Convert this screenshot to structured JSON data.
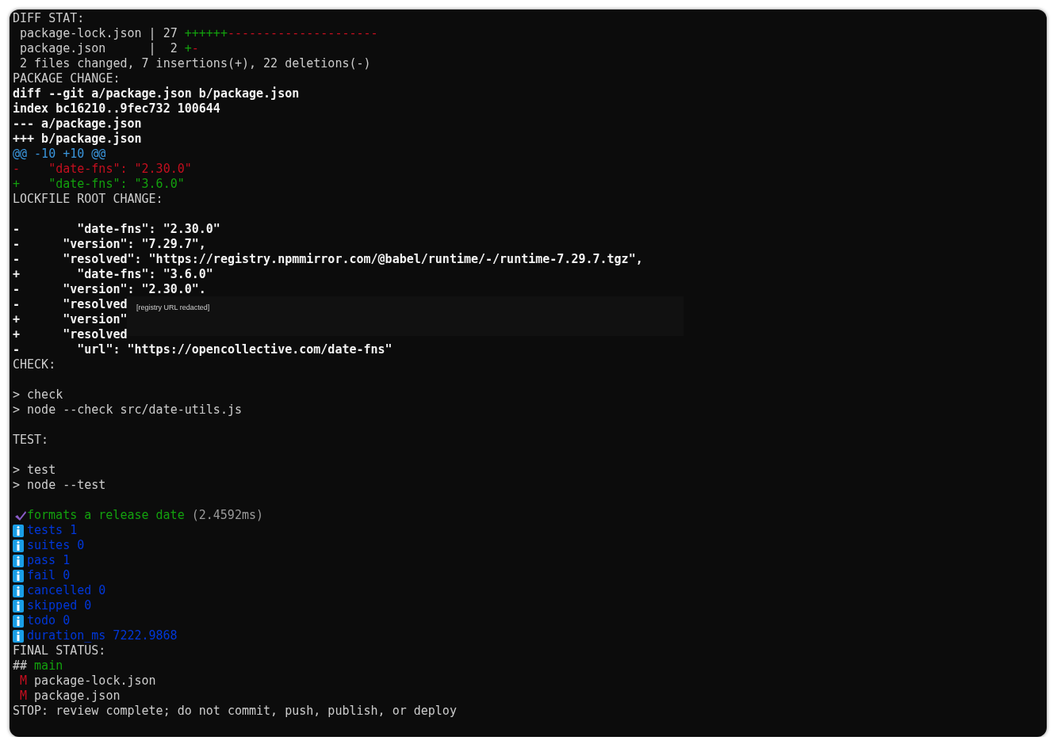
{
  "terminal": {
    "lines": [
      {
        "kind": "text",
        "segments": [
          {
            "kind": "plain",
            "text": "DIFF STAT:"
          }
        ]
      },
      {
        "kind": "text",
        "segments": [
          {
            "kind": "plain",
            "text": " package-lock.json | 27 "
          },
          {
            "kind": "added",
            "text": "++++++"
          },
          {
            "kind": "removed",
            "text": "---------------------"
          }
        ]
      },
      {
        "kind": "text",
        "segments": [
          {
            "kind": "plain",
            "text": " package.json      |  2 "
          },
          {
            "kind": "added",
            "text": "+"
          },
          {
            "kind": "removed",
            "text": "-"
          }
        ]
      },
      {
        "kind": "text",
        "segments": [
          {
            "kind": "plain",
            "text": " 2 files changed, 7 insertions(+), 22 deletions(-)"
          }
        ]
      },
      {
        "kind": "text",
        "segments": [
          {
            "kind": "plain",
            "text": "PACKAGE CHANGE:"
          }
        ]
      },
      {
        "kind": "text",
        "segments": [
          {
            "kind": "bold",
            "text": "diff --git a/package.json b/package.json"
          }
        ]
      },
      {
        "kind": "text",
        "segments": [
          {
            "kind": "bold",
            "text": "index bc16210..9fec732 100644"
          }
        ]
      },
      {
        "kind": "text",
        "segments": [
          {
            "kind": "bold",
            "text": "--- a/package.json"
          }
        ]
      },
      {
        "kind": "text",
        "segments": [
          {
            "kind": "bold",
            "text": "+++ b/package.json"
          }
        ]
      },
      {
        "kind": "text",
        "segments": [
          {
            "kind": "hunk",
            "text": "@@ -10 +10 @@"
          }
        ]
      },
      {
        "kind": "text",
        "segments": [
          {
            "kind": "removed",
            "text": "-    \"date-fns\": \"2.30.0\""
          }
        ]
      },
      {
        "kind": "text",
        "segments": [
          {
            "kind": "added",
            "text": "+    \"date-fns\": \"3.6.0\""
          }
        ]
      },
      {
        "kind": "text",
        "segments": [
          {
            "kind": "plain",
            "text": "LOCKFILE ROOT CHANGE:"
          }
        ]
      },
      {
        "kind": "blank"
      },
      {
        "kind": "text",
        "segments": [
          {
            "kind": "bold",
            "text": "-        \"date-fns\": \"2.30.0\""
          }
        ]
      },
      {
        "kind": "text",
        "segments": [
          {
            "kind": "bold",
            "text": "-      \"version\": \"7.29.7\","
          }
        ]
      },
      {
        "kind": "text",
        "segments": [
          {
            "kind": "bold",
            "text": "-      \"resolved\": \"https://registry.npmmirror.com/@babel/runtime/-/runtime-7.29.7.tgz\","
          }
        ]
      },
      {
        "kind": "text",
        "segments": [
          {
            "kind": "bold",
            "text": "+        \"date-fns\": \"3.6.0\""
          }
        ]
      },
      {
        "kind": "text",
        "segments": [
          {
            "kind": "bold",
            "text": "-      \"version\": \"2.30.0\"."
          }
        ]
      },
      {
        "kind": "text",
        "segments": [
          {
            "kind": "bold",
            "text": "-      \"resolved"
          }
        ],
        "redaction": "[registry URL redacted]"
      },
      {
        "kind": "text",
        "segments": [
          {
            "kind": "bold",
            "text": "+      \"version\""
          }
        ]
      },
      {
        "kind": "text",
        "segments": [
          {
            "kind": "bold",
            "text": "+      \"resolved"
          }
        ]
      },
      {
        "kind": "text",
        "segments": [
          {
            "kind": "bold",
            "text": "-        \"url\": \"https://opencollective.com/date-fns\""
          }
        ]
      },
      {
        "kind": "text",
        "segments": [
          {
            "kind": "plain",
            "text": "CHECK:"
          }
        ]
      },
      {
        "kind": "blank"
      },
      {
        "kind": "text",
        "segments": [
          {
            "kind": "plain",
            "text": "> check"
          }
        ]
      },
      {
        "kind": "text",
        "segments": [
          {
            "kind": "plain",
            "text": "> node --check src/date-utils.js"
          }
        ]
      },
      {
        "kind": "blank"
      },
      {
        "kind": "text",
        "segments": [
          {
            "kind": "plain",
            "text": "TEST:"
          }
        ]
      },
      {
        "kind": "blank"
      },
      {
        "kind": "text",
        "segments": [
          {
            "kind": "plain",
            "text": "> test"
          }
        ]
      },
      {
        "kind": "text",
        "segments": [
          {
            "kind": "plain",
            "text": "> node --test"
          }
        ]
      },
      {
        "kind": "blank"
      },
      {
        "kind": "check",
        "segments": [
          {
            "kind": "pass",
            "text": "formats a release date"
          },
          {
            "kind": "muted",
            "text": " (2.4592ms)"
          }
        ]
      },
      {
        "kind": "info",
        "segments": [
          {
            "kind": "info",
            "text": "tests 1"
          }
        ]
      },
      {
        "kind": "info",
        "segments": [
          {
            "kind": "info",
            "text": "suites 0"
          }
        ]
      },
      {
        "kind": "info",
        "segments": [
          {
            "kind": "info",
            "text": "pass 1"
          }
        ]
      },
      {
        "kind": "info",
        "segments": [
          {
            "kind": "info",
            "text": "fail 0"
          }
        ]
      },
      {
        "kind": "info",
        "segments": [
          {
            "kind": "info",
            "text": "cancelled 0"
          }
        ]
      },
      {
        "kind": "info",
        "segments": [
          {
            "kind": "info",
            "text": "skipped 0"
          }
        ]
      },
      {
        "kind": "info",
        "segments": [
          {
            "kind": "info",
            "text": "todo 0"
          }
        ]
      },
      {
        "kind": "info",
        "segments": [
          {
            "kind": "info",
            "text": "duration_ms 7222.9868"
          }
        ]
      },
      {
        "kind": "text",
        "segments": [
          {
            "kind": "plain",
            "text": "FINAL STATUS:"
          }
        ]
      },
      {
        "kind": "text",
        "segments": [
          {
            "kind": "plain",
            "text": "## "
          },
          {
            "kind": "branch",
            "text": "main"
          }
        ]
      },
      {
        "kind": "text",
        "segments": [
          {
            "kind": "modified",
            "text": " M"
          },
          {
            "kind": "plain",
            "text": " package-lock.json"
          }
        ]
      },
      {
        "kind": "text",
        "segments": [
          {
            "kind": "modified",
            "text": " M"
          },
          {
            "kind": "plain",
            "text": " package.json"
          }
        ]
      },
      {
        "kind": "text",
        "segments": [
          {
            "kind": "plain",
            "text": "STOP: review complete; do not commit, push, publish, or deploy"
          }
        ]
      }
    ]
  }
}
